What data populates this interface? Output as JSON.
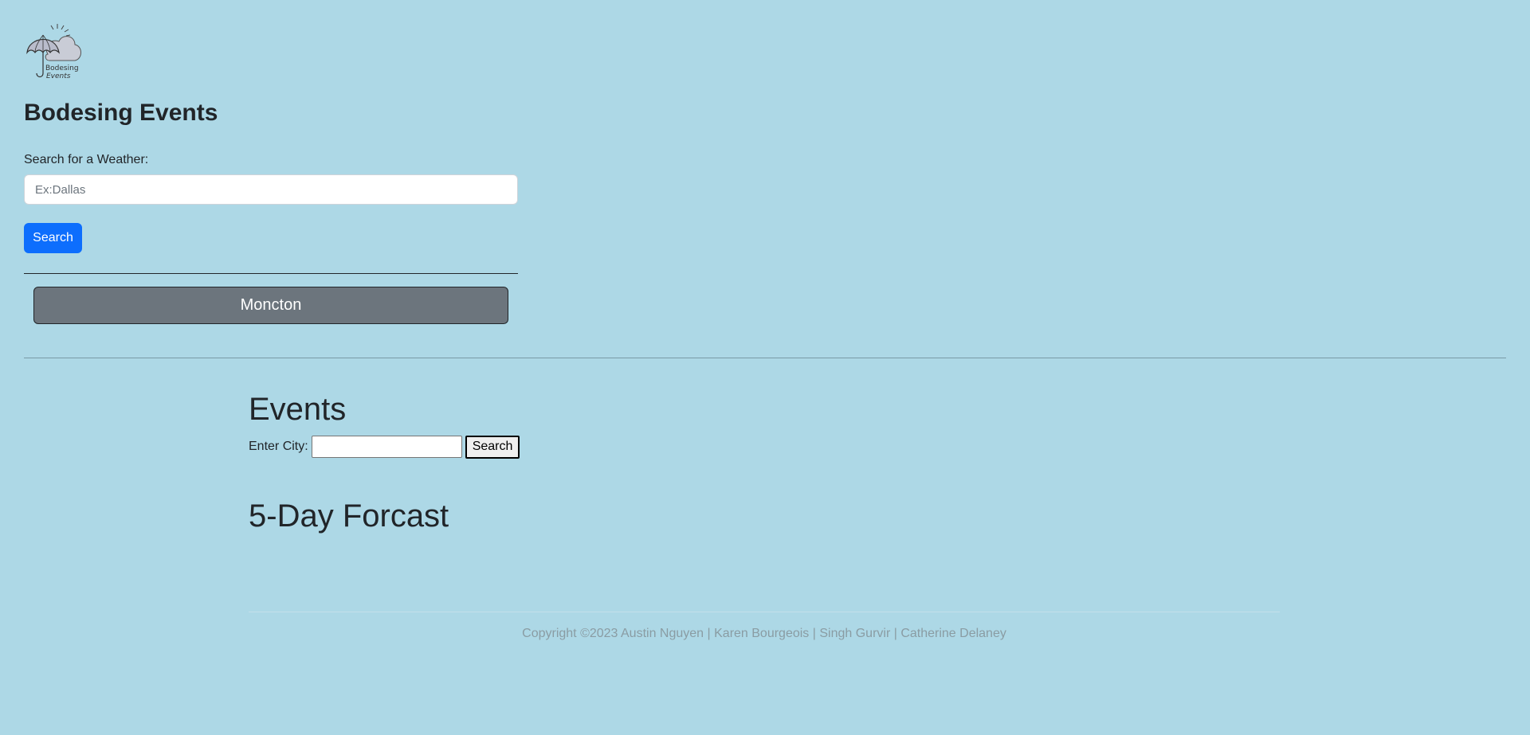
{
  "header": {
    "logo_text": "Bodesing Events",
    "title": "Bodesing Events"
  },
  "weather_search": {
    "label": "Search for a Weather:",
    "placeholder": "Ex:Dallas",
    "button_label": "Search"
  },
  "history": {
    "items": [
      "Moncton"
    ]
  },
  "events": {
    "heading": "Events",
    "city_label": "Enter City:",
    "button_label": "Search"
  },
  "forecast": {
    "heading": "5-Day Forcast"
  },
  "footer": {
    "copyright": "Copyright ©2023 Austin Nguyen | Karen Bourgeois | Singh Gurvir | Catherine Delaney"
  },
  "colors": {
    "background": "#add8e6",
    "primary_button": "#0d6efd",
    "history_button": "#6c757d"
  }
}
